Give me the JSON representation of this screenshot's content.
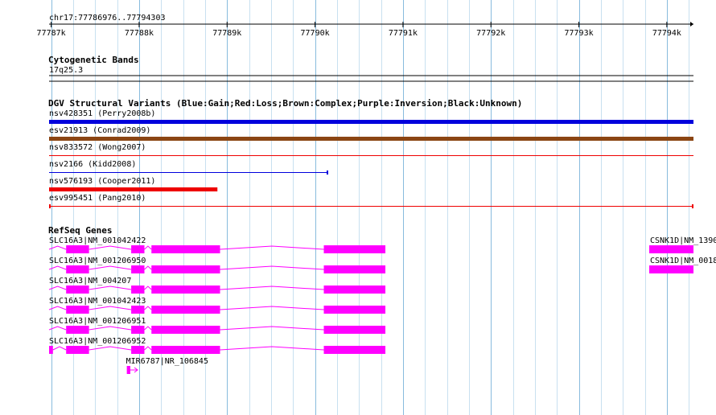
{
  "ruler": {
    "location": "chr17:77786976..77794303",
    "ticks": [
      "77787k",
      "77788k",
      "77789k",
      "77790k",
      "77791k",
      "77792k",
      "77793k",
      "77794k"
    ]
  },
  "tracks": {
    "cytoband": {
      "title": "Cytogenetic Bands",
      "band_label": "17q25.3"
    },
    "dgv": {
      "title": "DGV Structural Variants (Blue:Gain;Red:Loss;Brown:Complex;Purple:Inversion;Black:Unknown)",
      "features": [
        {
          "label": "nsv428351 (Perry2008b)",
          "color": "#0000dd",
          "start": 77786976,
          "end": 77794303,
          "style": "thick"
        },
        {
          "label": "esv21913 (Conrad2009)",
          "color": "#8b4513",
          "start": 77786976,
          "end": 77794303,
          "style": "thick"
        },
        {
          "label": "nsv833572 (Wong2007)",
          "color": "#ee0000",
          "start": 77786976,
          "end": 77794303,
          "style": "line"
        },
        {
          "label": "nsv2166 (Kidd2008)",
          "color": "#0000dd",
          "start": 77786976,
          "end": 77790150,
          "style": "line-endcap"
        },
        {
          "label": "nsv576193 (Cooper2011)",
          "color": "#ee0000",
          "start": 77786976,
          "end": 77788890,
          "style": "thick"
        },
        {
          "label": "esv995451 (Pang2010)",
          "color": "#ee0000",
          "start": 77786976,
          "end": 77794303,
          "style": "line-bothcaps"
        }
      ]
    },
    "refseq": {
      "title": "RefSeq Genes",
      "color": "#ff00ff",
      "genes": [
        {
          "label": "SLC16A3|NM_001042422",
          "start": 77786976,
          "end": 77790800,
          "exons": [
            [
              77787170,
              77787430
            ],
            [
              77787910,
              77788060
            ],
            [
              77788140,
              77788920
            ],
            [
              77790100,
              77790800
            ]
          ]
        },
        {
          "label": "SLC16A3|NM_001206950",
          "start": 77786976,
          "end": 77790800,
          "exons": [
            [
              77787170,
              77787430
            ],
            [
              77787910,
              77788060
            ],
            [
              77788140,
              77788920
            ],
            [
              77790100,
              77790800
            ]
          ]
        },
        {
          "label": "SLC16A3|NM_004207",
          "start": 77786976,
          "end": 77790800,
          "exons": [
            [
              77787170,
              77787430
            ],
            [
              77787910,
              77788060
            ],
            [
              77788140,
              77788920
            ],
            [
              77790100,
              77790800
            ]
          ]
        },
        {
          "label": "SLC16A3|NM_001042423",
          "start": 77786976,
          "end": 77790800,
          "exons": [
            [
              77787170,
              77787430
            ],
            [
              77787910,
              77788060
            ],
            [
              77788140,
              77788920
            ],
            [
              77790100,
              77790800
            ]
          ]
        },
        {
          "label": "SLC16A3|NM_001206951",
          "start": 77786976,
          "end": 77790800,
          "exons": [
            [
              77787170,
              77787430
            ],
            [
              77787910,
              77788060
            ],
            [
              77788140,
              77788920
            ],
            [
              77790100,
              77790800
            ]
          ]
        },
        {
          "label": "SLC16A3|NM_001206952",
          "start": 77786976,
          "end": 77790800,
          "exons": [
            [
              77786976,
              77787020
            ],
            [
              77787170,
              77787430
            ],
            [
              77787910,
              77788060
            ],
            [
              77788140,
              77788920
            ],
            [
              77790100,
              77790800
            ]
          ]
        },
        {
          "label": "MIR6787|NR_106845",
          "start": 77787860,
          "end": 77787960,
          "exons": [
            [
              77787860,
              77787900
            ]
          ],
          "strand_arrow": true
        },
        {
          "label": "CSNK1D|NM_1390",
          "start": 77793800,
          "end": 77794303,
          "exons": [
            [
              77793800,
              77794303
            ]
          ]
        },
        {
          "label": "CSNK1D|NM_0018",
          "start": 77793800,
          "end": 77794303,
          "exons": [
            [
              77793800,
              77794303
            ]
          ]
        }
      ]
    }
  }
}
